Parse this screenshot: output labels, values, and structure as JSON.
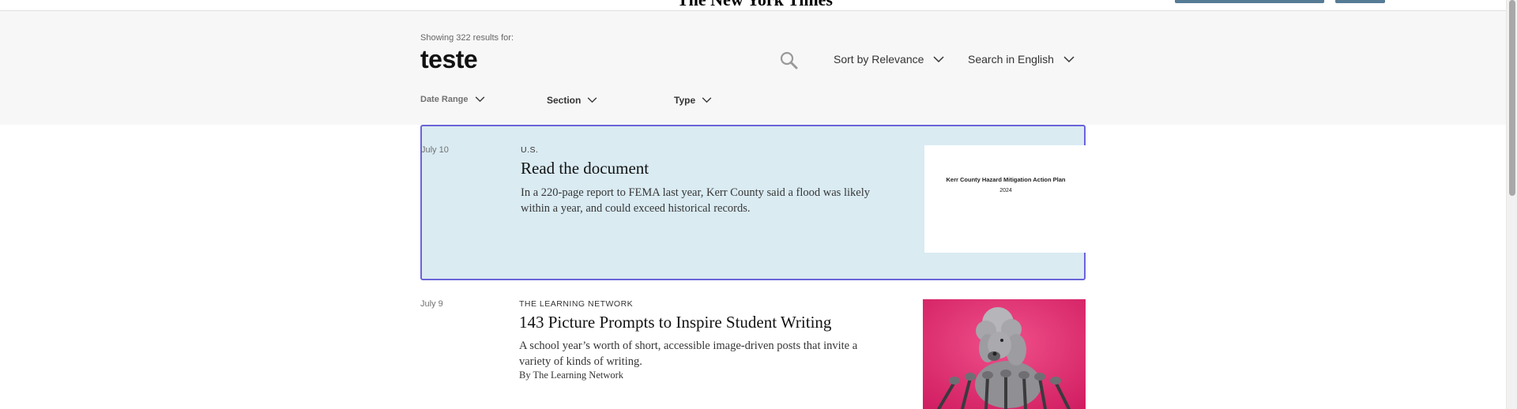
{
  "header": {
    "masthead_clip": "The New York Times"
  },
  "search": {
    "showing_text": "Showing 322 results for:",
    "query": "teste",
    "sort_label": "Sort by Relevance",
    "language_label": "Search in English"
  },
  "filters": {
    "date_range": "Date Range",
    "section": "Section",
    "type": "Type"
  },
  "results": [
    {
      "date": "July 10",
      "kicker": "U.S.",
      "headline": "Read the document",
      "summary": "In a 220-page report to FEMA last year, Kerr County said a flood was likely within a year, and could exceed historical records.",
      "thumbnail": {
        "doc_title": "Kerr County Hazard Mitigation Action Plan",
        "doc_year": "2024"
      }
    },
    {
      "date": "July 9",
      "kicker": "THE LEARNING NETWORK",
      "headline": "143 Picture Prompts to Inspire Student Writing",
      "summary": "A school year’s worth of short, accessible image-driven posts that invite a variety of kinds of writing.",
      "byline": "By The Learning Network",
      "thumbnail": {
        "description_icon": "poodle-with-microphones-image"
      }
    }
  ],
  "colors": {
    "highlight_bg": "#daebf2",
    "highlight_border": "#6b63d8",
    "header_bg": "#f7f7f7",
    "thumbnail_pink": "#e0306e"
  }
}
